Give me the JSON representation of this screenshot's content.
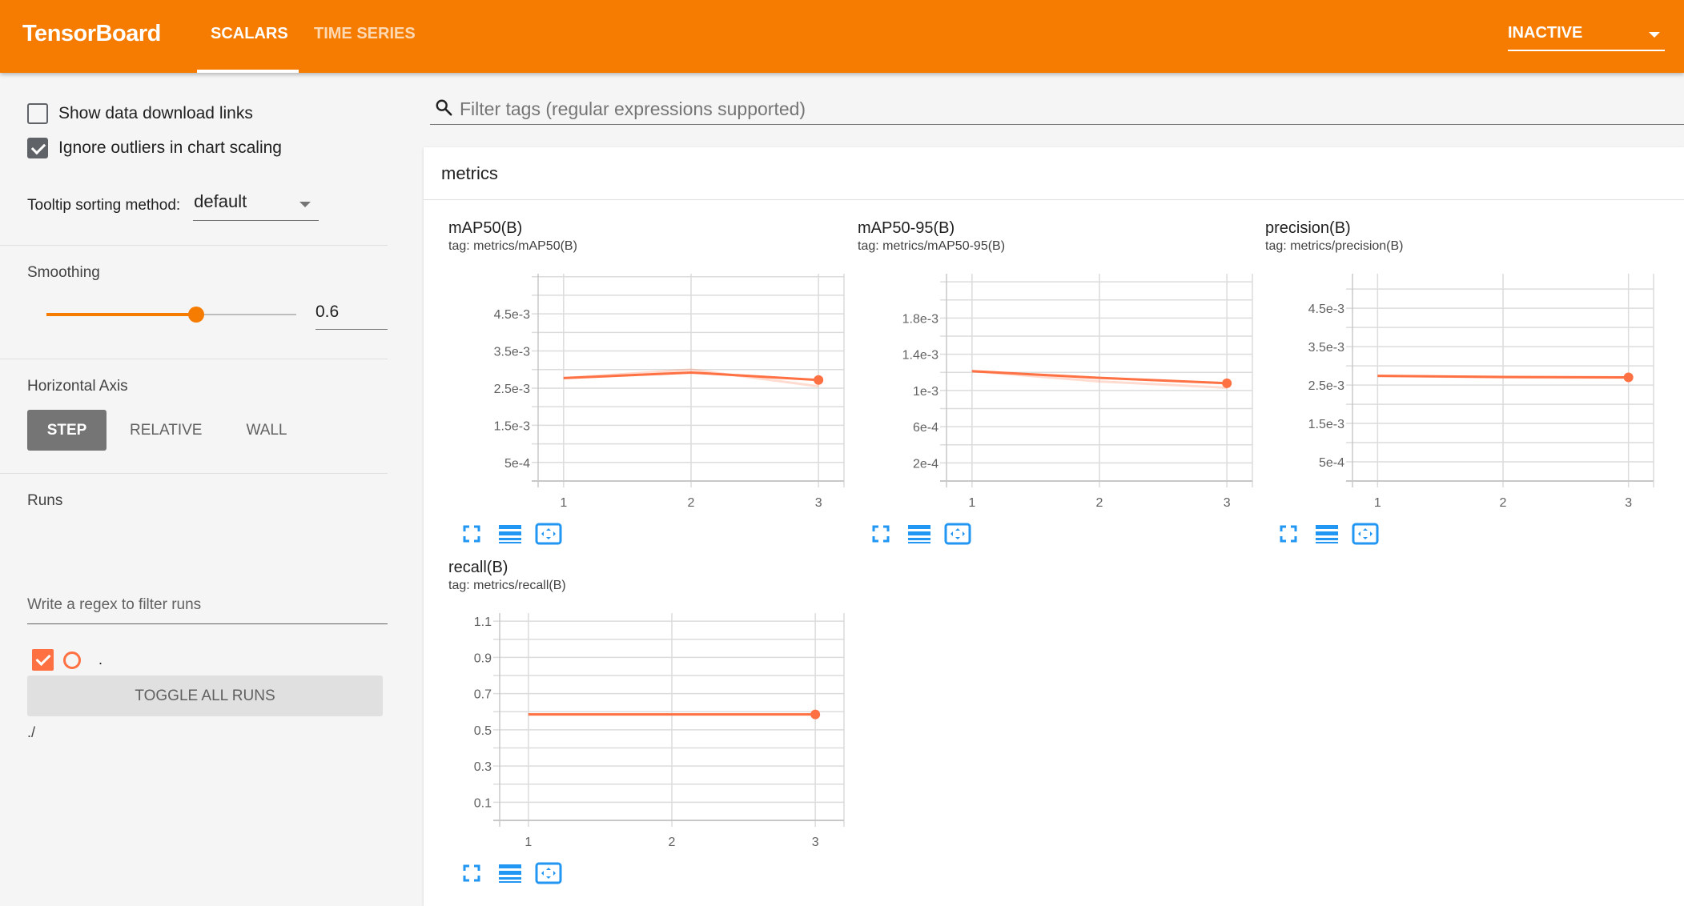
{
  "header": {
    "brand": "TensorBoard",
    "tabs": [
      {
        "label": "SCALARS",
        "active": true
      },
      {
        "label": "TIME SERIES",
        "active": false
      }
    ],
    "status_select": "INACTIVE",
    "colors": {
      "brand": "#f57c00",
      "run": "#ff7043",
      "icon": "#2196f3"
    }
  },
  "sidebar": {
    "show_download_links": {
      "label": "Show data download links",
      "checked": false
    },
    "ignore_outliers": {
      "label": "Ignore outliers in chart scaling",
      "checked": true
    },
    "tooltip_sorting": {
      "label": "Tooltip sorting method:",
      "value": "default"
    },
    "smoothing": {
      "title": "Smoothing",
      "value": "0.6",
      "fraction": 0.6
    },
    "horizontal_axis": {
      "title": "Horizontal Axis",
      "options": [
        "STEP",
        "RELATIVE",
        "WALL"
      ],
      "selected": "STEP"
    },
    "runs": {
      "title": "Runs",
      "filter_placeholder": "Write a regex to filter runs",
      "items": [
        {
          "name": ".",
          "checked": true
        }
      ],
      "toggle_label": "TOGGLE ALL RUNS",
      "path": "./"
    }
  },
  "main": {
    "search_placeholder": "Filter tags (regular expressions supported)",
    "group_title": "metrics",
    "icons": [
      "fullscreen-icon",
      "toggle-log-scale-icon",
      "fit-domain-icon"
    ]
  },
  "chart_data": [
    {
      "type": "line",
      "title": "mAP50(B)",
      "tag": "tag: metrics/mAP50(B)",
      "x": [
        1,
        2,
        3
      ],
      "xticks": [
        "1",
        "2",
        "3"
      ],
      "yticks": [
        0.0005,
        0.0015,
        0.0025,
        0.0035,
        0.0045
      ],
      "ytick_labels": [
        "5e-4",
        "1.5e-3",
        "2.5e-3",
        "3.5e-3",
        "4.5e-3"
      ],
      "minor_step": 0.0005,
      "ylim": [
        0,
        0.00558
      ],
      "xlim": [
        0.8,
        3.2
      ],
      "series": [
        {
          "name": ". (raw)",
          "values": [
            0.00277,
            0.003,
            0.00255
          ]
        },
        {
          "name": ". (smoothed)",
          "values": [
            0.00277,
            0.00292,
            0.00272
          ]
        }
      ],
      "grid": true
    },
    {
      "type": "line",
      "title": "mAP50-95(B)",
      "tag": "tag: metrics/mAP50-95(B)",
      "x": [
        1,
        2,
        3
      ],
      "xticks": [
        "1",
        "2",
        "3"
      ],
      "yticks": [
        0.0002,
        0.0006,
        0.001,
        0.0014,
        0.0018
      ],
      "ytick_labels": [
        "2e-4",
        "6e-4",
        "1e-3",
        "1.4e-3",
        "1.8e-3"
      ],
      "minor_step": 0.0002,
      "ylim": [
        0,
        0.00229
      ],
      "xlim": [
        0.8,
        3.2
      ],
      "series": [
        {
          "name": ". (raw)",
          "values": [
            0.001213,
            0.0011,
            0.00103
          ]
        },
        {
          "name": ". (smoothed)",
          "values": [
            0.001213,
            0.00114,
            0.00108
          ]
        }
      ],
      "grid": true
    },
    {
      "type": "line",
      "title": "precision(B)",
      "tag": "tag: metrics/precision(B)",
      "x": [
        1,
        2,
        3
      ],
      "xticks": [
        "1",
        "2",
        "3"
      ],
      "yticks": [
        0.0005,
        0.0015,
        0.0025,
        0.0035,
        0.0045
      ],
      "ytick_labels": [
        "5e-4",
        "1.5e-3",
        "2.5e-3",
        "3.5e-3",
        "4.5e-3"
      ],
      "minor_step": 0.0005,
      "ylim": [
        0,
        0.0054
      ],
      "xlim": [
        0.8,
        3.2
      ],
      "series": [
        {
          "name": ". (raw)",
          "values": [
            0.00274,
            0.0027,
            0.00269
          ]
        },
        {
          "name": ". (smoothed)",
          "values": [
            0.00274,
            0.00271,
            0.0027
          ]
        }
      ],
      "grid": true
    },
    {
      "type": "line",
      "title": "recall(B)",
      "tag": "tag: metrics/recall(B)",
      "x": [
        1,
        2,
        3
      ],
      "xticks": [
        "1",
        "2",
        "3"
      ],
      "yticks": [
        0.1,
        0.3,
        0.5,
        0.7,
        0.9,
        1.1
      ],
      "ytick_labels": [
        "0.1",
        "0.3",
        "0.5",
        "0.7",
        "0.9",
        "1.1"
      ],
      "minor_step": 0.1,
      "ylim": [
        0,
        1.145
      ],
      "xlim": [
        0.8,
        3.2
      ],
      "series": [
        {
          "name": ". (raw)",
          "values": [
            0.585,
            0.585,
            0.585
          ]
        },
        {
          "name": ". (smoothed)",
          "values": [
            0.585,
            0.585,
            0.585
          ]
        }
      ],
      "grid": true
    }
  ]
}
